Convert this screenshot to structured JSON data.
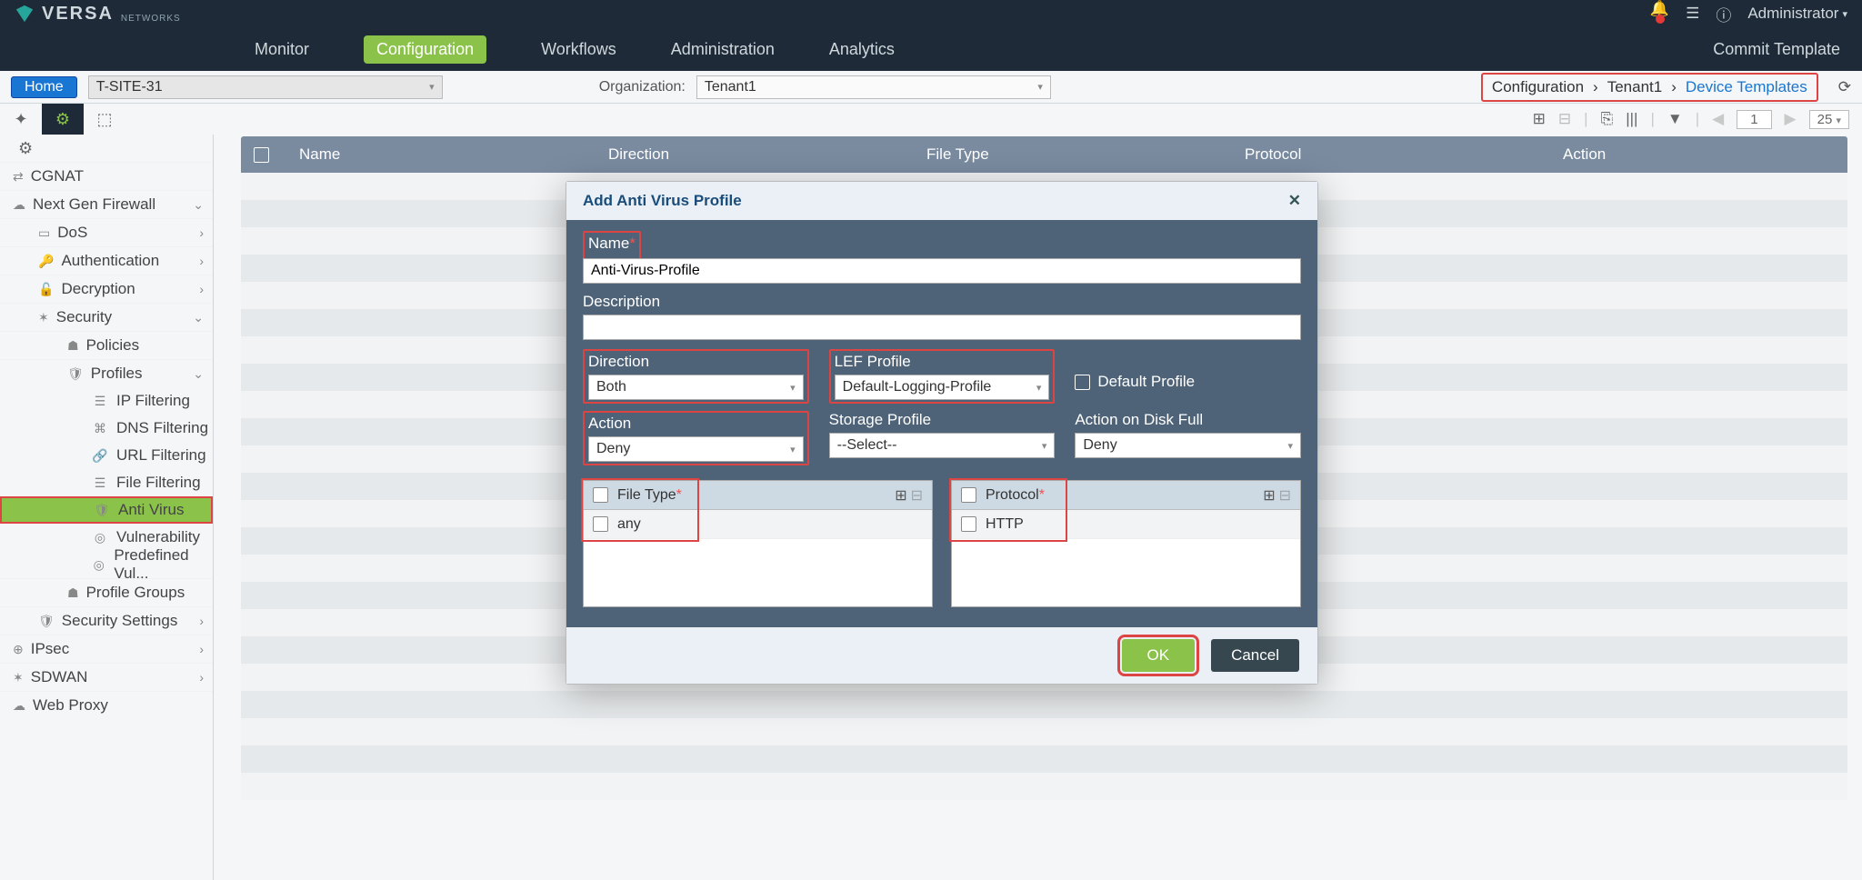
{
  "header": {
    "brand": "VERSA",
    "brand_sub": "NETWORKS",
    "user_label": "Administrator"
  },
  "nav": {
    "items": [
      {
        "label": "Monitor",
        "key": "monitor"
      },
      {
        "label": "Configuration",
        "key": "config",
        "active": true
      },
      {
        "label": "Workflows",
        "key": "workflows"
      },
      {
        "label": "Administration",
        "key": "admin"
      },
      {
        "label": "Analytics",
        "key": "analytics"
      }
    ],
    "commit": "Commit Template"
  },
  "subbar": {
    "home": "Home",
    "site": "T-SITE-31",
    "org_label": "Organization:",
    "org": "Tenant1",
    "breadcrumb": {
      "a": "Configuration",
      "b": "Tenant1",
      "c": "Device Templates"
    }
  },
  "toolrow": {
    "page": "1",
    "per_page": "25"
  },
  "sidebar": {
    "cgnat": "CGNAT",
    "ngfw": "Next Gen Firewall",
    "dos": "DoS",
    "auth": "Authentication",
    "decr": "Decryption",
    "security": "Security",
    "policies": "Policies",
    "profiles": "Profiles",
    "ipf": "IP Filtering",
    "dnsf": "DNS Filtering",
    "urlf": "URL Filtering",
    "filef": "File Filtering",
    "av": "Anti Virus",
    "vuln": "Vulnerability",
    "pvul": "Predefined Vul...",
    "pg": "Profile Groups",
    "secs": "Security Settings",
    "ipsec": "IPsec",
    "sdwan": "SDWAN",
    "webp": "Web Proxy"
  },
  "table": {
    "cols": {
      "name": "Name",
      "dir": "Direction",
      "ft": "File Type",
      "proto": "Protocol",
      "act": "Action"
    }
  },
  "modal": {
    "title": "Add Anti Virus Profile",
    "fields": {
      "name_label": "Name",
      "name_value": "Anti-Virus-Profile",
      "desc_label": "Description",
      "desc_value": "",
      "direction_label": "Direction",
      "direction_value": "Both",
      "lef_label": "LEF Profile",
      "lef_value": "Default-Logging-Profile",
      "default_profile": "Default Profile",
      "action_label": "Action",
      "action_value": "Deny",
      "storage_label": "Storage Profile",
      "storage_value": "--Select--",
      "diskfull_label": "Action on Disk Full",
      "diskfull_value": "Deny",
      "filetype_header": "File Type",
      "filetype_row": "any",
      "protocol_header": "Protocol",
      "protocol_row": "HTTP"
    },
    "buttons": {
      "ok": "OK",
      "cancel": "Cancel"
    }
  }
}
